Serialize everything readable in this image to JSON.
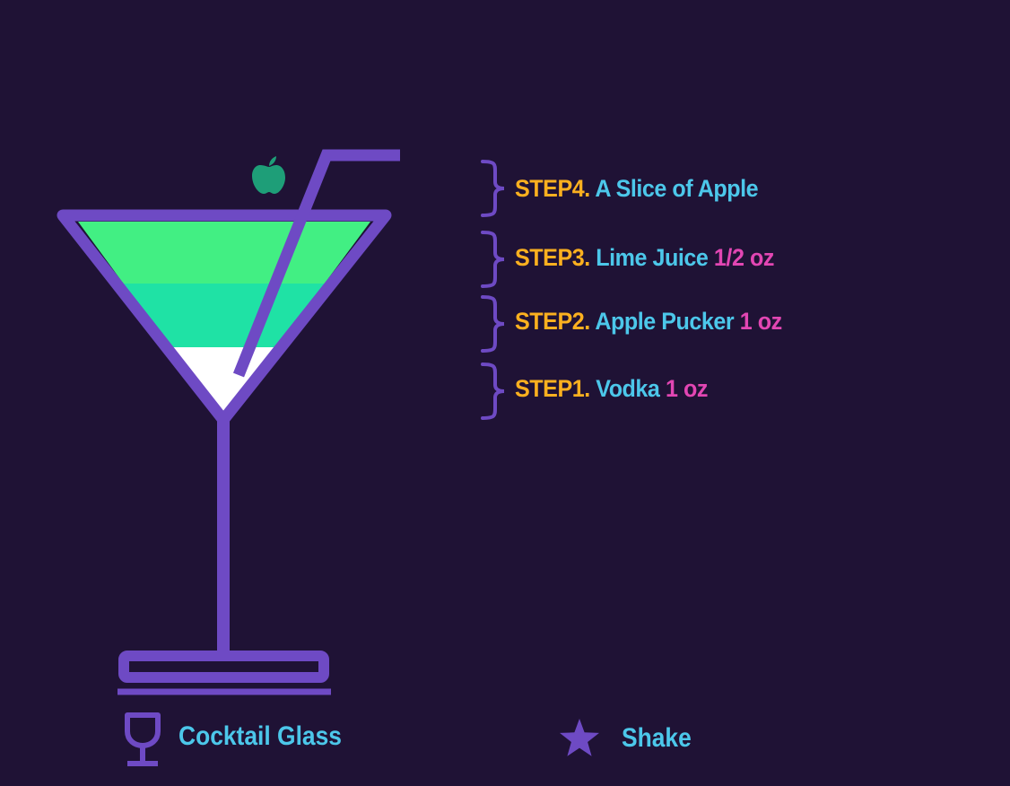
{
  "colors": {
    "background": "#1f1235",
    "outline": "#6e4ac4",
    "layer_top": "#42ef83",
    "layer_middle": "#1fe2a5",
    "layer_bottom": "#ffffff",
    "apple": "#1e9e78",
    "step_label": "#fbb01f",
    "ingredient": "#4cc7ea",
    "amount": "#e246b3"
  },
  "garnish": {
    "icon": "apple-icon"
  },
  "steps": [
    {
      "label": "STEP4.",
      "ingredient": "A Slice of Apple",
      "amount": ""
    },
    {
      "label": "STEP3.",
      "ingredient": "Lime Juice",
      "amount": "1/2 oz"
    },
    {
      "label": "STEP2.",
      "ingredient": "Apple Pucker",
      "amount": "1 oz"
    },
    {
      "label": "STEP1.",
      "ingredient": "Vodka",
      "amount": "1 oz"
    }
  ],
  "legend": {
    "glass": {
      "label": "Cocktail Glass",
      "icon": "cocktail-glass-icon"
    },
    "method": {
      "label": "Shake",
      "icon": "star-icon"
    }
  }
}
